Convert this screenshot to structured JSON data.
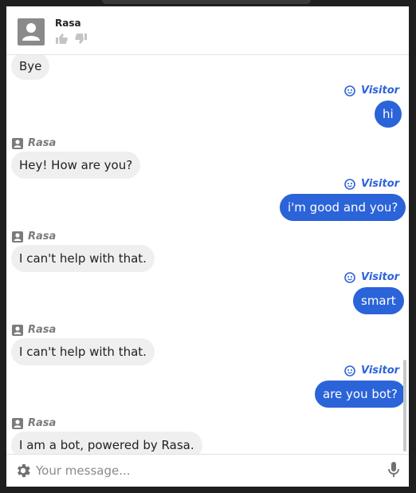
{
  "header": {
    "bot_name": "Rasa"
  },
  "messages": [
    {
      "from": "bot",
      "sender": "",
      "text": "Bye"
    },
    {
      "from": "user",
      "sender": "Visitor",
      "text": "hi"
    },
    {
      "from": "bot",
      "sender": "Rasa",
      "text": "Hey! How are you?"
    },
    {
      "from": "user",
      "sender": "Visitor",
      "text": "i'm good and you?"
    },
    {
      "from": "bot",
      "sender": "Rasa",
      "text": "I can't help with that."
    },
    {
      "from": "user",
      "sender": "Visitor",
      "text": "smart"
    },
    {
      "from": "bot",
      "sender": "Rasa",
      "text": "I can't help with that."
    },
    {
      "from": "user",
      "sender": "Visitor",
      "text": "are you bot?"
    },
    {
      "from": "bot",
      "sender": "Rasa",
      "text": "I am a bot, powered by Rasa."
    }
  ],
  "composer": {
    "placeholder": "Your message..."
  },
  "icons": {
    "bot_avatar": "person-avatar-icon",
    "visitor": "smiley-face-icon",
    "settings": "gear-icon",
    "voice": "microphone-icon",
    "like": "thumbs-up-icon",
    "dislike": "thumbs-down-icon"
  },
  "colors": {
    "accent": "#2b63d9",
    "bot_bubble": "#efefef",
    "bot_label": "#7b7b7b"
  }
}
